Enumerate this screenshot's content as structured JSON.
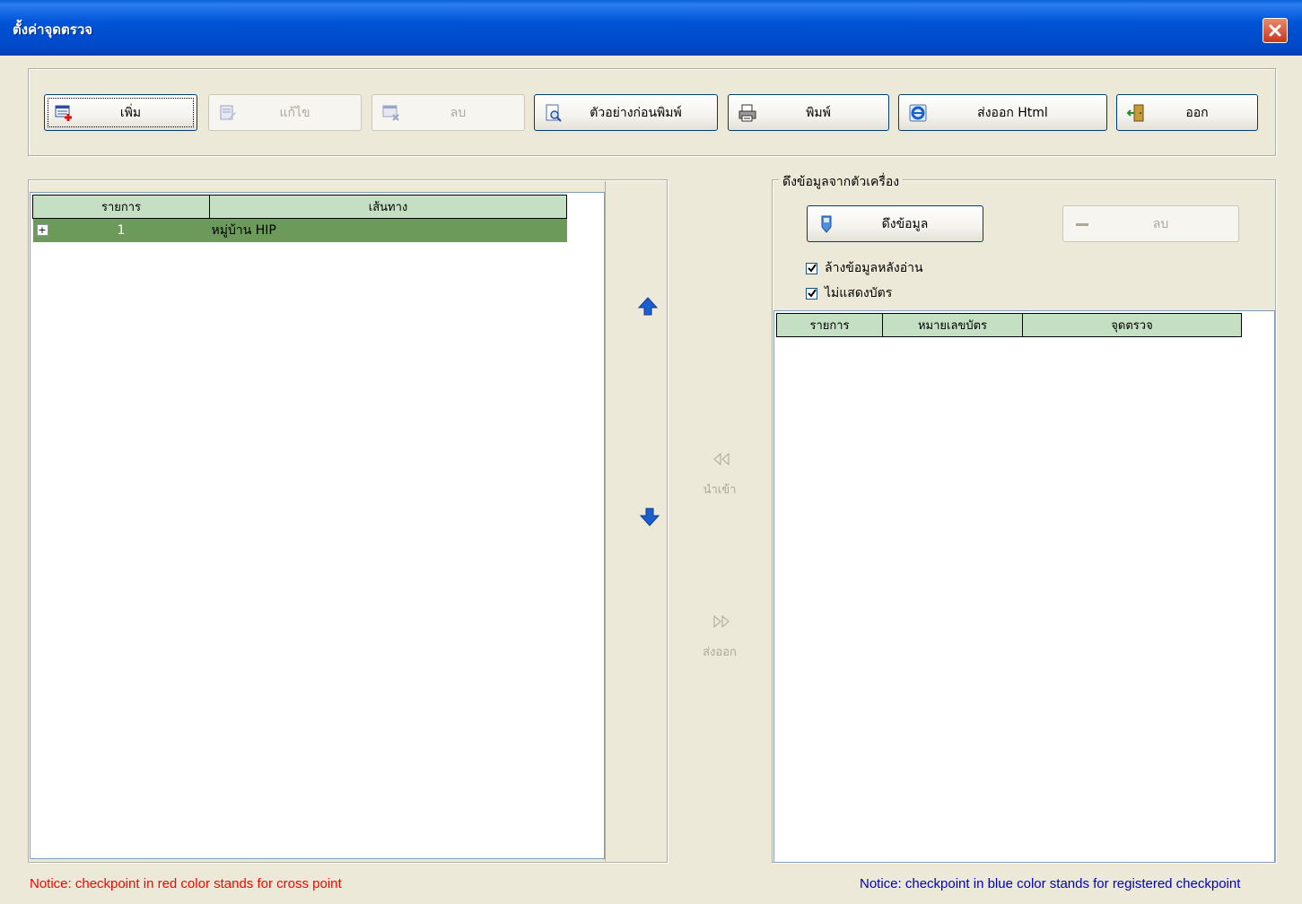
{
  "window": {
    "title": "ตั้งค่าจุดตรวจ"
  },
  "toolbar": {
    "add_label": "เพิ่ม",
    "edit_label": "แก้ไข",
    "delete_label": "ลบ",
    "preview_label": "ตัวอย่างก่อนพิมพ์",
    "print_label": "พิมพ์",
    "export_html_label": "ส่งออก Html",
    "exit_label": "ออก"
  },
  "left_list": {
    "columns": [
      "รายการ",
      "เส้นทาง"
    ],
    "rows": [
      {
        "expander": "+",
        "index": "1",
        "route": "หมู่บ้าน HIP"
      }
    ]
  },
  "move": {
    "import_label": "นำเข้า",
    "export_label": "ส่งออก"
  },
  "device_panel": {
    "title": "ดึงข้อมูลจากตัวเครื่อง",
    "fetch_label": "ดึงข้อมูล",
    "delete_label": "ลบ",
    "clear_after_read_label": "ล้างข้อมูลหลังอ่าน",
    "clear_after_read_checked": true,
    "hide_card_label": "ไม่แสดงบัตร",
    "hide_card_checked": true,
    "columns": [
      "รายการ",
      "หมายเลขบัตร",
      "จุดตรวจ"
    ]
  },
  "notices": {
    "red": "Notice: checkpoint in red color stands for cross point",
    "blue": "Notice: checkpoint in blue color stands for registered checkpoint"
  },
  "colors": {
    "title_bar": "#0053d6",
    "header_bg": "#c4dfc4",
    "selected_row": "#6b9a5a",
    "notice_red": "#ff0000",
    "notice_blue": "#0000c0"
  }
}
